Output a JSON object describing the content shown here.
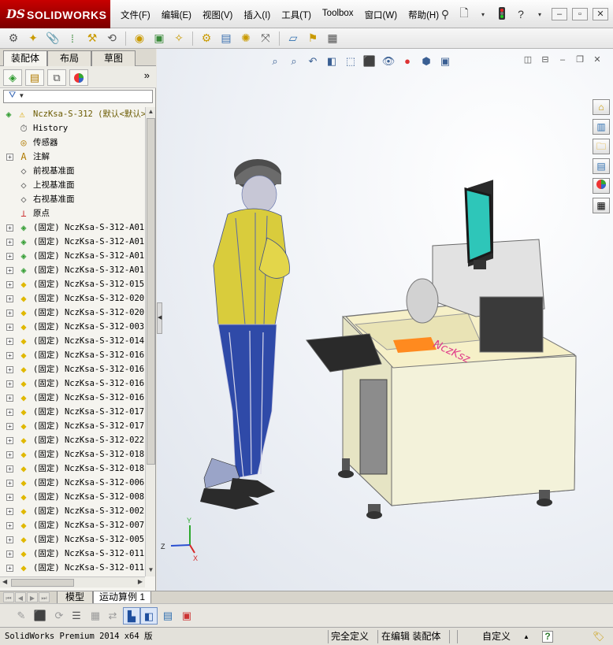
{
  "app": {
    "logo_prefix": "DS",
    "logo_name": "SOLIDWORKS"
  },
  "menu": [
    "文件(F)",
    "编辑(E)",
    "视图(V)",
    "插入(I)",
    "工具(T)",
    "Toolbox",
    "窗口(W)",
    "帮助(H)"
  ],
  "panel": {
    "tabs": [
      "装配体",
      "布局",
      "草图"
    ],
    "active_tab": "装配体",
    "filter_glyph": "▼"
  },
  "tree": {
    "root": "NczKsa-S-312  (默认<默认>",
    "fixed_items": [
      {
        "label": "History",
        "icon": "history-icon"
      },
      {
        "label": "传感器",
        "icon": "sensor-icon"
      },
      {
        "label": "注解",
        "icon": "annotation-icon",
        "expandable": true
      },
      {
        "label": "前视基准面",
        "icon": "plane-icon"
      },
      {
        "label": "上视基准面",
        "icon": "plane-icon"
      },
      {
        "label": "右视基准面",
        "icon": "plane-icon"
      },
      {
        "label": "原点",
        "icon": "origin-icon"
      }
    ],
    "components": [
      {
        "label": "(固定) NczKsa-S-312-A01",
        "kind": "assembly"
      },
      {
        "label": "(固定) NczKsa-S-312-A01",
        "kind": "assembly"
      },
      {
        "label": "(固定) NczKsa-S-312-A01",
        "kind": "assembly"
      },
      {
        "label": "(固定) NczKsa-S-312-A01",
        "kind": "assembly"
      },
      {
        "label": "(固定) NczKsa-S-312-015",
        "kind": "part"
      },
      {
        "label": "(固定) NczKsa-S-312-020",
        "kind": "part"
      },
      {
        "label": "(固定) NczKsa-S-312-020",
        "kind": "part"
      },
      {
        "label": "(固定) NczKsa-S-312-003",
        "kind": "part"
      },
      {
        "label": "(固定) NczKsa-S-312-014",
        "kind": "part"
      },
      {
        "label": "(固定) NczKsa-S-312-016",
        "kind": "part"
      },
      {
        "label": "(固定) NczKsa-S-312-016",
        "kind": "part"
      },
      {
        "label": "(固定) NczKsa-S-312-016",
        "kind": "part"
      },
      {
        "label": "(固定) NczKsa-S-312-016",
        "kind": "part"
      },
      {
        "label": "(固定) NczKsa-S-312-017",
        "kind": "part"
      },
      {
        "label": "(固定) NczKsa-S-312-017",
        "kind": "part"
      },
      {
        "label": "(固定) NczKsa-S-312-022",
        "kind": "part"
      },
      {
        "label": "(固定) NczKsa-S-312-018",
        "kind": "part"
      },
      {
        "label": "(固定) NczKsa-S-312-018",
        "kind": "part"
      },
      {
        "label": "(固定) NczKsa-S-312-006",
        "kind": "part"
      },
      {
        "label": "(固定) NczKsa-S-312-008",
        "kind": "part"
      },
      {
        "label": "(固定) NczKsa-S-312-002",
        "kind": "part"
      },
      {
        "label": "(固定) NczKsa-S-312-007",
        "kind": "part"
      },
      {
        "label": "(固定) NczKsa-S-312-005",
        "kind": "part"
      },
      {
        "label": "(固定) NczKsa-S-312-011",
        "kind": "part"
      },
      {
        "label": "(固定) NczKsa-S-312-011",
        "kind": "part"
      }
    ]
  },
  "triad": {
    "x": "X",
    "y": "Y",
    "z": "Z"
  },
  "bottom_tabs": [
    "模型",
    "运动算例 1"
  ],
  "active_bottom_tab": "模型",
  "status": {
    "app_version": "SolidWorks Premium 2014 x64 版",
    "definition": "完全定义",
    "editing": "在编辑 装配体",
    "units": "自定义",
    "units_arrow": "▲",
    "help": "?"
  },
  "colors": {
    "brand_red": "#c80000",
    "assembly_green": "#2f9b2f",
    "part_yellow": "#e0b800",
    "warning_yellow": "#f2c200"
  }
}
